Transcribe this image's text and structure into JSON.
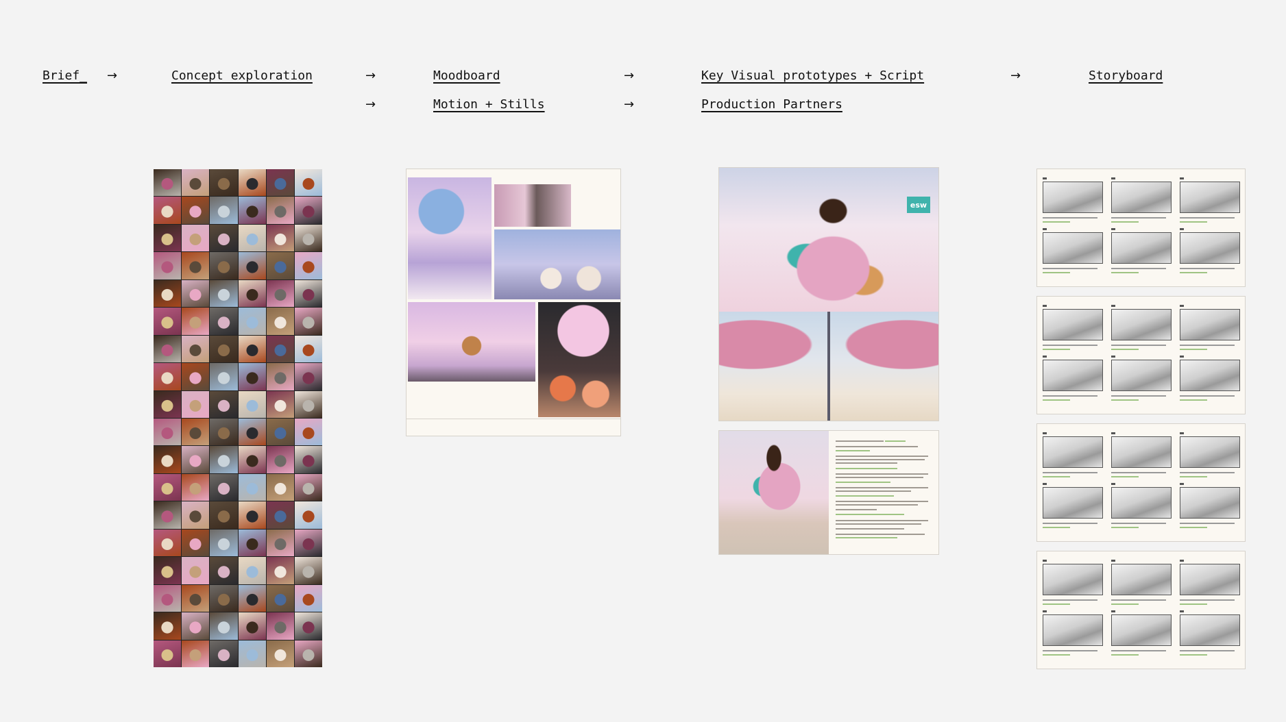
{
  "nav": {
    "row1": [
      {
        "id": "brief",
        "label": "Brief_"
      },
      {
        "id": "concept",
        "label": "Concept exploration"
      },
      {
        "id": "moodboard",
        "label": "Moodboard"
      },
      {
        "id": "keyvisual",
        "label": "Key Visual prototypes + Script"
      },
      {
        "id": "storyboard",
        "label": "Storyboard"
      }
    ],
    "row2": [
      {
        "id": "motion",
        "label": "Motion + Stills"
      },
      {
        "id": "production",
        "label": "Production Partners"
      }
    ],
    "arrow": "→"
  },
  "colors": {
    "background": "#f3f3f3",
    "paper": "#fbf8f2",
    "pink": "#e4a4c2",
    "teal": "#3fb3ac",
    "lavender": "#b9a9d8"
  },
  "concept_grid": {
    "palette": [
      "#3a2a1e",
      "#8a6b4a",
      "#c4a07a",
      "#e9d9c4",
      "#b9b4ad",
      "#6e6a66",
      "#2a2a2e",
      "#d9b2c4",
      "#e8a8c4",
      "#b4587e",
      "#7b3450",
      "#4a6a9a",
      "#9cbbd9",
      "#c9d3da",
      "#5a4a3a",
      "#d9c08a",
      "#a8481e",
      "#f0e6dc"
    ],
    "rows": 18,
    "cols": 6
  },
  "badge": "esw"
}
